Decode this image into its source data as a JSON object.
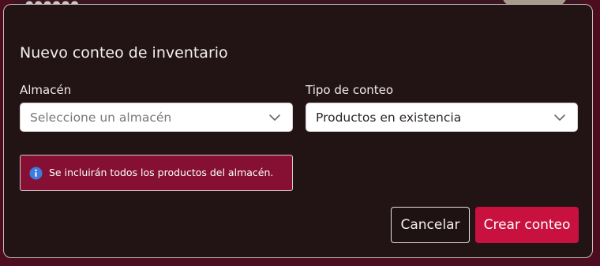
{
  "dialog": {
    "title": "Nuevo conteo de inventario",
    "warehouse": {
      "label": "Almacén",
      "placeholder": "Seleccione un almacén",
      "icon": "chevron-down-icon"
    },
    "count_type": {
      "label": "Tipo de conteo",
      "value": "Productos en existencia",
      "icon": "chevron-down-icon"
    },
    "info": {
      "icon": "info-icon",
      "text": "Se incluirán todos los productos del almacén."
    },
    "buttons": {
      "cancel": "Cancelar",
      "create": "Crear conteo"
    }
  },
  "colors": {
    "accent": "#c8113e",
    "info_background": "#851034",
    "dialog_background": "#221415",
    "info_icon": "#3d7be0"
  }
}
